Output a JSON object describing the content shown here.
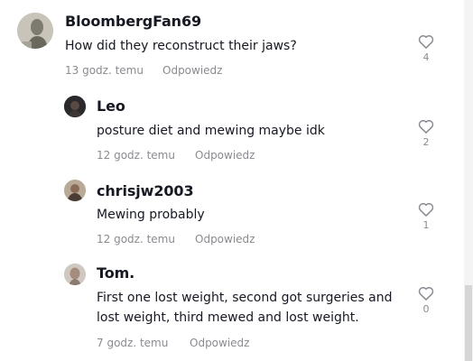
{
  "comments": [
    {
      "username": "BloombergFan69",
      "text": "How did they reconstruct their jaws?",
      "time": "13 godz. temu",
      "reply_label": "Odpowiedz",
      "likes": "4",
      "avatar_icon": "statue-avatar"
    },
    {
      "username": "Leo",
      "text": "posture diet and mewing maybe idk",
      "time": "12 godz. temu",
      "reply_label": "Odpowiedz",
      "likes": "2",
      "avatar_icon": "dark-avatar"
    },
    {
      "username": "chrisjw2003",
      "text": "Mewing probably",
      "time": "12 godz. temu",
      "reply_label": "Odpowiedz",
      "likes": "1",
      "avatar_icon": "person-avatar"
    },
    {
      "username": "Tom.",
      "text": "First one lost weight, second got surgeries and\nlost weight, third mewed and lost weight.",
      "time": "7 godz. temu",
      "reply_label": "Odpowiedz",
      "likes": "0",
      "avatar_icon": "face-avatar"
    }
  ],
  "colors": {
    "text": "#161823",
    "muted": "#8a8b91",
    "background": "#ffffff"
  }
}
